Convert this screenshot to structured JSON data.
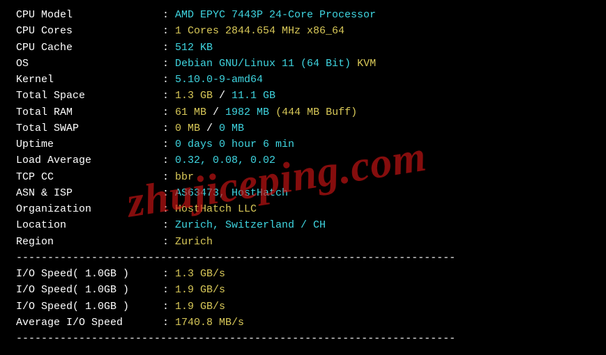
{
  "rows": [
    {
      "label": "CPU Model",
      "parts": [
        {
          "text": "AMD EPYC 7443P 24-Core Processor",
          "cls": "val-cyan"
        }
      ]
    },
    {
      "label": "CPU Cores",
      "parts": [
        {
          "text": "1 Cores 2844.654 MHz x86_64",
          "cls": "val-yellow"
        }
      ]
    },
    {
      "label": "CPU Cache",
      "parts": [
        {
          "text": "512 KB",
          "cls": "val-cyan"
        }
      ]
    },
    {
      "label": "OS",
      "parts": [
        {
          "text": "Debian GNU/Linux 11 (64 Bit) ",
          "cls": "val-cyan"
        },
        {
          "text": "KVM",
          "cls": "val-yellow"
        }
      ]
    },
    {
      "label": "Kernel",
      "parts": [
        {
          "text": "5.10.0-9-amd64",
          "cls": "val-cyan"
        }
      ]
    },
    {
      "label": "Total Space",
      "parts": [
        {
          "text": "1.3 GB ",
          "cls": "val-yellow"
        },
        {
          "text": "/ ",
          "cls": "val-white"
        },
        {
          "text": "11.1 GB",
          "cls": "val-cyan"
        }
      ]
    },
    {
      "label": "Total RAM",
      "parts": [
        {
          "text": "61 MB ",
          "cls": "val-yellow"
        },
        {
          "text": "/ ",
          "cls": "val-white"
        },
        {
          "text": "1982 MB ",
          "cls": "val-cyan"
        },
        {
          "text": "(444 MB Buff)",
          "cls": "val-yellow"
        }
      ]
    },
    {
      "label": "Total SWAP",
      "parts": [
        {
          "text": "0 MB ",
          "cls": "val-yellow"
        },
        {
          "text": "/ ",
          "cls": "val-white"
        },
        {
          "text": "0 MB",
          "cls": "val-cyan"
        }
      ]
    },
    {
      "label": "Uptime",
      "parts": [
        {
          "text": "0 days 0 hour 6 min",
          "cls": "val-cyan"
        }
      ]
    },
    {
      "label": "Load Average",
      "parts": [
        {
          "text": "0.32, 0.08, 0.02",
          "cls": "val-cyan"
        }
      ]
    },
    {
      "label": "TCP CC",
      "parts": [
        {
          "text": "bbr",
          "cls": "val-yellow"
        }
      ]
    },
    {
      "label": "ASN & ISP",
      "parts": [
        {
          "text": "AS63473, HostHatch",
          "cls": "val-cyan"
        }
      ]
    },
    {
      "label": "Organization",
      "parts": [
        {
          "text": "HostHatch LLC",
          "cls": "val-yellow"
        }
      ]
    },
    {
      "label": "Location",
      "parts": [
        {
          "text": "Zurich, Switzerland / CH",
          "cls": "val-cyan"
        }
      ]
    },
    {
      "label": "Region",
      "parts": [
        {
          "text": "Zurich",
          "cls": "val-yellow"
        }
      ]
    }
  ],
  "io_rows": [
    {
      "label": "I/O Speed( 1.0GB )",
      "value": "1.3 GB/s"
    },
    {
      "label": "I/O Speed( 1.0GB )",
      "value": "1.9 GB/s"
    },
    {
      "label": "I/O Speed( 1.0GB )",
      "value": "1.9 GB/s"
    },
    {
      "label": "Average I/O Speed",
      "value": "1740.8 MB/s"
    }
  ],
  "divider": "----------------------------------------------------------------------",
  "watermark": "zhujiceping.com",
  "colon": " : "
}
